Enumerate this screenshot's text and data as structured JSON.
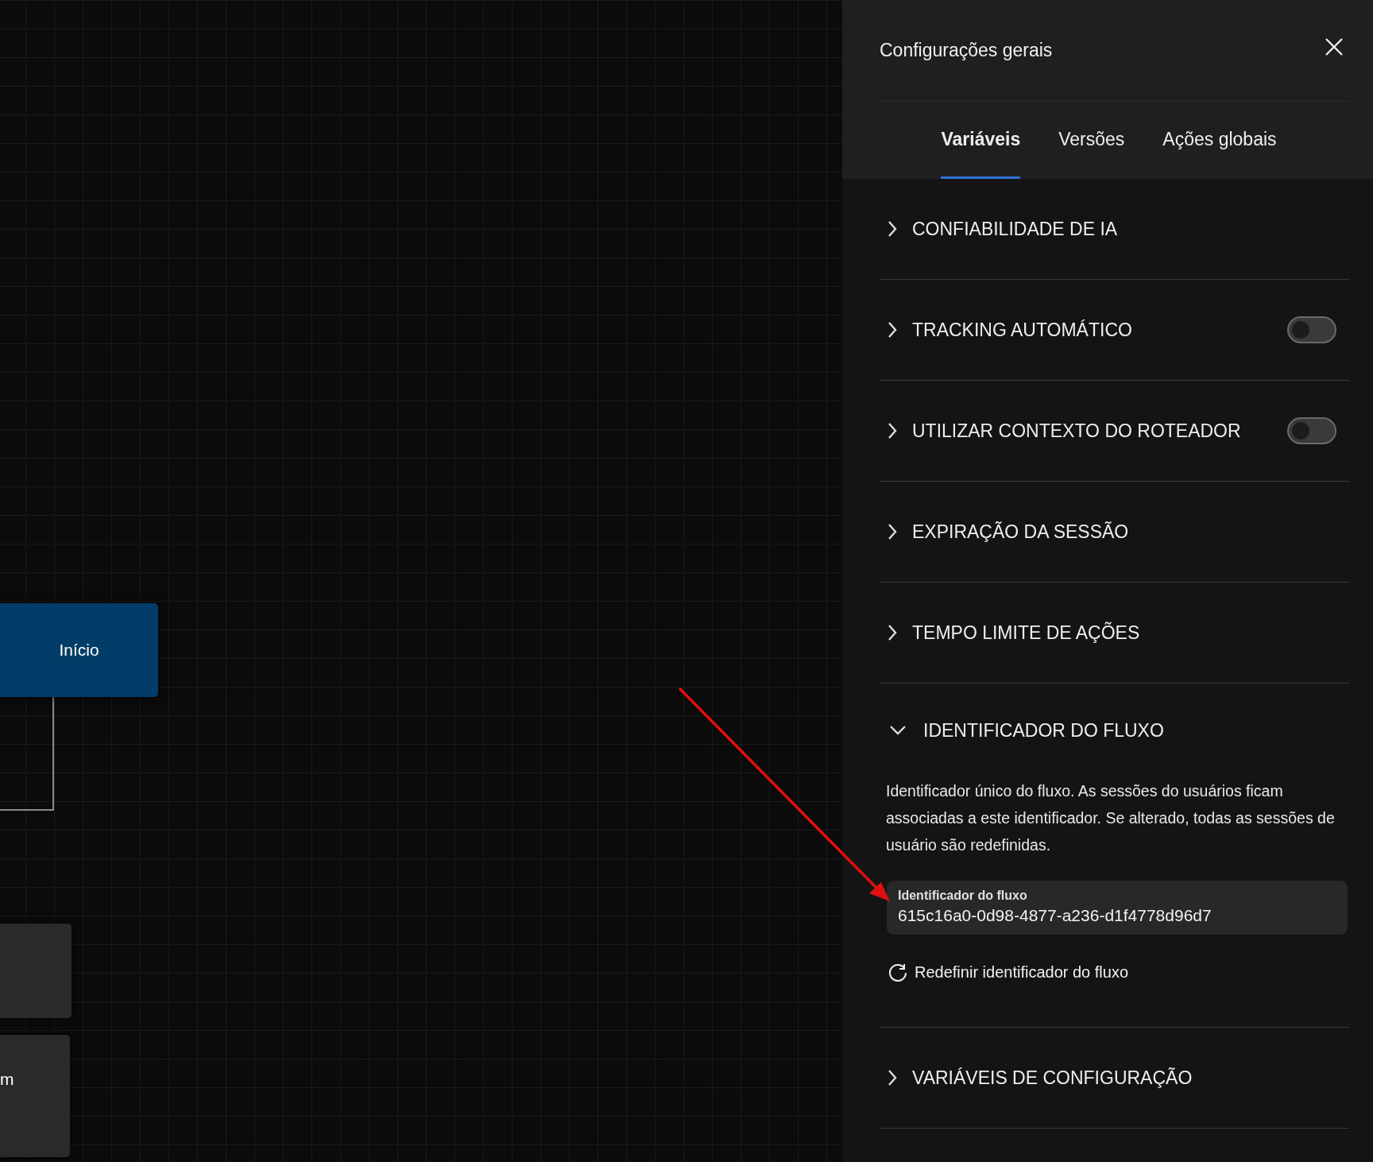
{
  "canvas": {
    "nodes": [
      {
        "kind": "start",
        "label": "Início"
      },
      {
        "kind": "plain"
      },
      {
        "kind": "plain",
        "label": "m"
      }
    ]
  },
  "panel": {
    "title": "Configurações gerais",
    "tabs": [
      {
        "label": "Variáveis",
        "selected": true
      },
      {
        "label": "Versões",
        "selected": false
      },
      {
        "label": "Ações globais",
        "selected": false
      }
    ],
    "sections": [
      {
        "kind": "plain",
        "title": "CONFIABILIDADE DE IA",
        "expanded": false
      },
      {
        "kind": "toggle",
        "title": "TRACKING AUTOMÁTICO",
        "expanded": false,
        "on": false
      },
      {
        "kind": "toggle",
        "title": "UTILIZAR CONTEXTO DO ROTEADOR",
        "expanded": false,
        "on": false
      },
      {
        "kind": "plain",
        "title": "EXPIRAÇÃO DA SESSÃO",
        "expanded": false
      },
      {
        "kind": "plain",
        "title": "TEMPO LIMITE DE AÇÕES",
        "expanded": false
      },
      {
        "kind": "plain",
        "title": "IDENTIFICADOR DO FLUXO",
        "expanded": true,
        "description": "Identificador único do fluxo. As sessões do usuários ficam associadas a este identificador. Se alterado, todas as sessões de usuário são redefinidas.",
        "field": {
          "label": "Identificador do fluxo",
          "value": "615c16a0-0d98-4877-a236-d1f4778d96d7"
        },
        "reset_link": "Redefinir identificador do fluxo"
      },
      {
        "kind": "plain",
        "title": "VARIÁVEIS DE CONFIGURAÇÃO",
        "expanded": false
      }
    ]
  }
}
